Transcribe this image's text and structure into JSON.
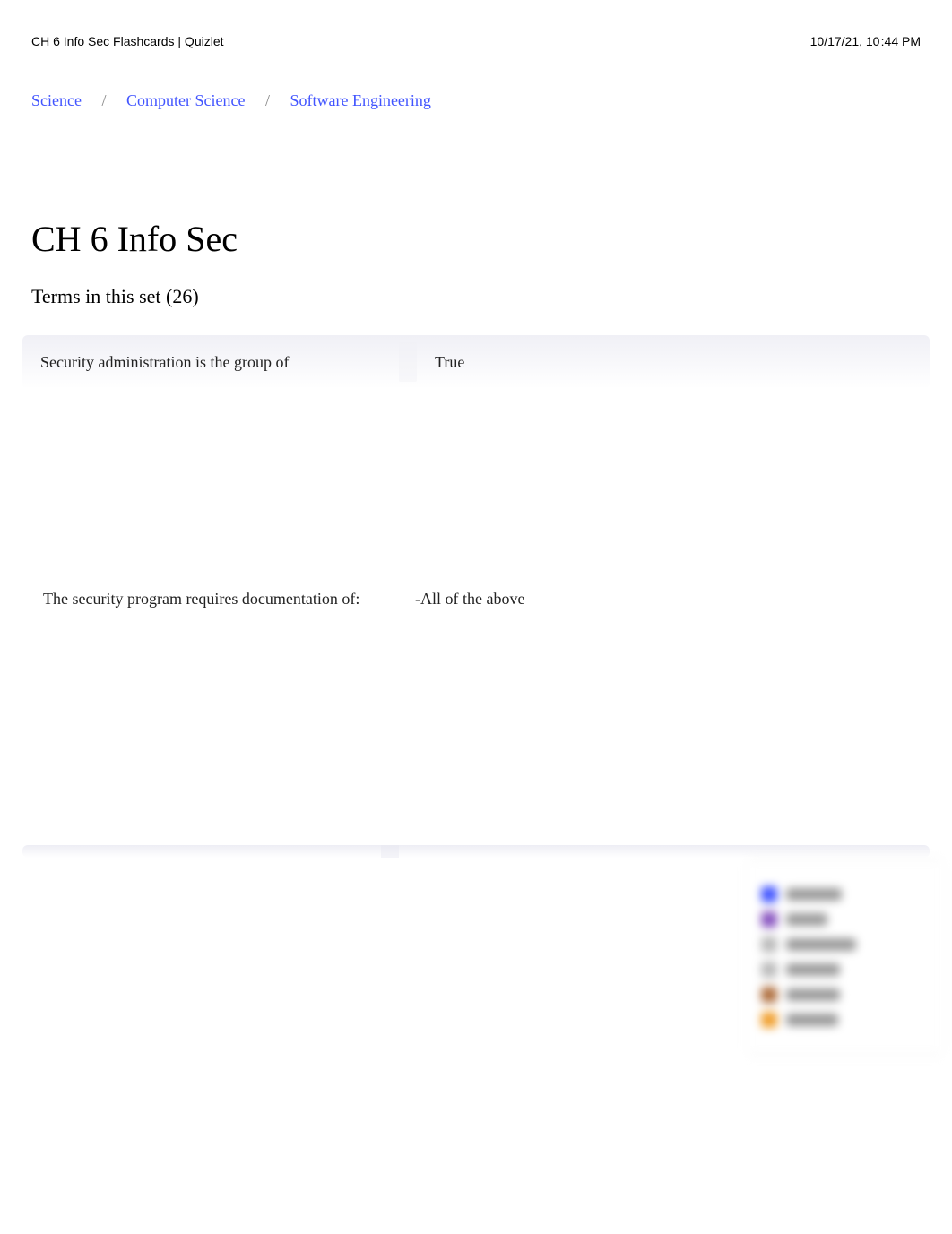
{
  "header": {
    "left": "CH 6 Info Sec Flashcards | Quizlet",
    "right": "10/17/21, 10 :44 PM"
  },
  "breadcrumb": {
    "items": [
      "Science",
      "Computer Science",
      "Software Engineering"
    ]
  },
  "page": {
    "title": "CH 6 Info Sec",
    "subtitle": "Terms in this set (26)"
  },
  "cards": [
    {
      "term": "Security administration is the group of",
      "definition": "True"
    },
    {
      "term": "The security program requires documentation of:",
      "definition": "-All of the above"
    }
  ],
  "sidepanel": {
    "items": [
      {
        "iconColor": "c-blue",
        "labelWidth": 62
      },
      {
        "iconColor": "c-purple",
        "labelWidth": 46
      },
      {
        "iconColor": "c-gray",
        "labelWidth": 78
      },
      {
        "iconColor": "c-gray",
        "labelWidth": 60
      },
      {
        "iconColor": "c-brown",
        "labelWidth": 60
      },
      {
        "iconColor": "c-orange",
        "labelWidth": 58
      }
    ]
  }
}
